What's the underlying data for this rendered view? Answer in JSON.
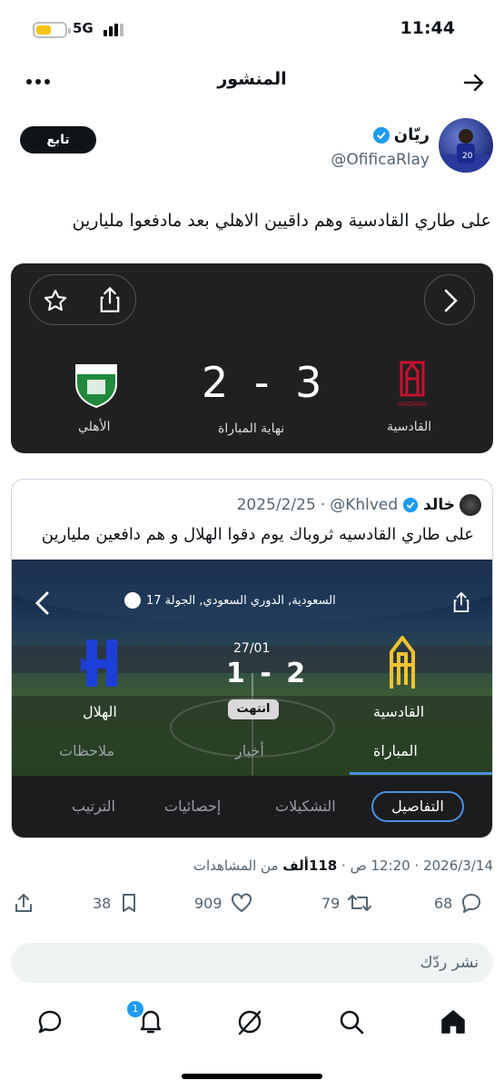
{
  "status_bar": {
    "network": "5G",
    "time": "11:44",
    "battery_icon": "battery-icon",
    "signal_icon": "signal-bars-icon"
  },
  "header": {
    "title": "المنشور",
    "back_icon": "arrow-right-icon",
    "more_icon": "more-dots-icon"
  },
  "author": {
    "name": "ريّان",
    "handle": "@OfificaRlay",
    "follow_label": "تابع",
    "verified_icon": "verified-badge-icon"
  },
  "tweet": {
    "text": "على طاري القادسية وهم داقيين الاهلي بعد مادفعوا مليارين"
  },
  "match_card": {
    "home_team": "القادسية",
    "home_logo_text": "GADSIAH",
    "away_team": "الأهلي",
    "home_score": "3",
    "away_score": "2",
    "separator": "-",
    "status": "نهاية المباراة",
    "icons": [
      "star-icon",
      "share-icon",
      "chevron-right-icon"
    ],
    "colors": {
      "background": "#202020",
      "home": "#c8102e",
      "away": "#1f8a3c"
    }
  },
  "quoted": {
    "name": "خالد",
    "handle": "@Khlved",
    "date": "2025/2/25",
    "separator": "·",
    "text": "على طاري القادسيه ثروباك يوم دقوا الهلال و هم دافعين مليارين",
    "league": "السعودية, الدوري السعودي, الجولة 17",
    "match_date": "27/01",
    "home_team": "القادسية",
    "away_team": "الهلال",
    "home_score": "2",
    "away_score": "1",
    "separator_score": "-",
    "status": "انتهت",
    "sub_tabs": [
      "المباراة",
      "أخبار",
      "ملاحظات"
    ],
    "tabs": [
      "التفاصيل",
      "التشكيلات",
      "إحصائيات",
      "الترتيب"
    ],
    "active_tab": "التفاصيل",
    "colors": {
      "home": "#f2c230",
      "away": "#1d3fd9",
      "accent": "#4a90e2"
    }
  },
  "meta": {
    "date": "2026/3/14",
    "time": "12:20 ص",
    "dot": "·",
    "views_count": "118",
    "views_unit": "ألف",
    "views_label": "من المشاهدات"
  },
  "actions": {
    "replies": "68",
    "retweets": "79",
    "likes": "909",
    "bookmarks": "38"
  },
  "reply_box": {
    "placeholder": "نشر ردّك"
  },
  "bottom_nav": {
    "notification_badge": "1",
    "items": [
      "home-icon",
      "search-icon",
      "grok-icon",
      "notifications-icon",
      "messages-icon"
    ]
  }
}
